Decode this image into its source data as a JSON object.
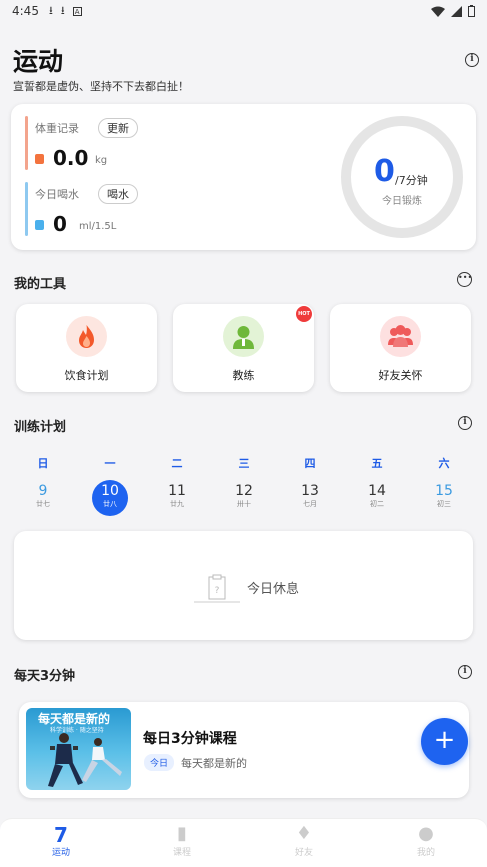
{
  "status_bar": {
    "time": "4:45"
  },
  "header": {
    "title": "运动",
    "subtitle": "宣誓都是虚伪、坚持不下去都白扯！"
  },
  "stats": {
    "weight": {
      "label": "体重记录",
      "button": "更新",
      "value": "0.0",
      "unit": "kg",
      "color": "#f3a48d"
    },
    "water": {
      "label": "今日喝水",
      "button": "喝水",
      "value": "0",
      "unit": "ml/1.5L",
      "color": "#8ec9f0"
    },
    "exercise": {
      "value": "0",
      "unit": "/7分钟",
      "label": "今日锻炼"
    }
  },
  "tools": {
    "title": "我的工具",
    "items": [
      {
        "label": "饮食计划",
        "icon": "flame-icon"
      },
      {
        "label": "教练",
        "icon": "coach-icon",
        "badge": "HOT"
      },
      {
        "label": "好友关怀",
        "icon": "friends-icon"
      }
    ]
  },
  "plan": {
    "title": "训练计划",
    "days": [
      {
        "week": "日",
        "num": "9",
        "lunar": "廿七"
      },
      {
        "week": "一",
        "num": "10",
        "lunar": "廿八"
      },
      {
        "week": "二",
        "num": "11",
        "lunar": "廿九"
      },
      {
        "week": "三",
        "num": "12",
        "lunar": "卅十"
      },
      {
        "week": "四",
        "num": "13",
        "lunar": "七月"
      },
      {
        "week": "五",
        "num": "14",
        "lunar": "初二"
      },
      {
        "week": "六",
        "num": "15",
        "lunar": "初三"
      }
    ],
    "rest_text": "今日休息"
  },
  "daily": {
    "title": "每天3分钟",
    "course": {
      "thumb_title": "每天都是新的",
      "thumb_sub": "科学训练 · 随之坚持",
      "title": "每日3分钟课程",
      "tag": "今日",
      "desc": "每天都是新的"
    }
  },
  "tabbar": {
    "items": [
      {
        "label": "运动",
        "icon": "7"
      },
      {
        "label": "课程",
        "icon": "▮"
      },
      {
        "label": "好友",
        "icon": "♦"
      },
      {
        "label": "我的",
        "icon": "●"
      }
    ]
  },
  "colors": {
    "accent": "#1e5be6"
  }
}
